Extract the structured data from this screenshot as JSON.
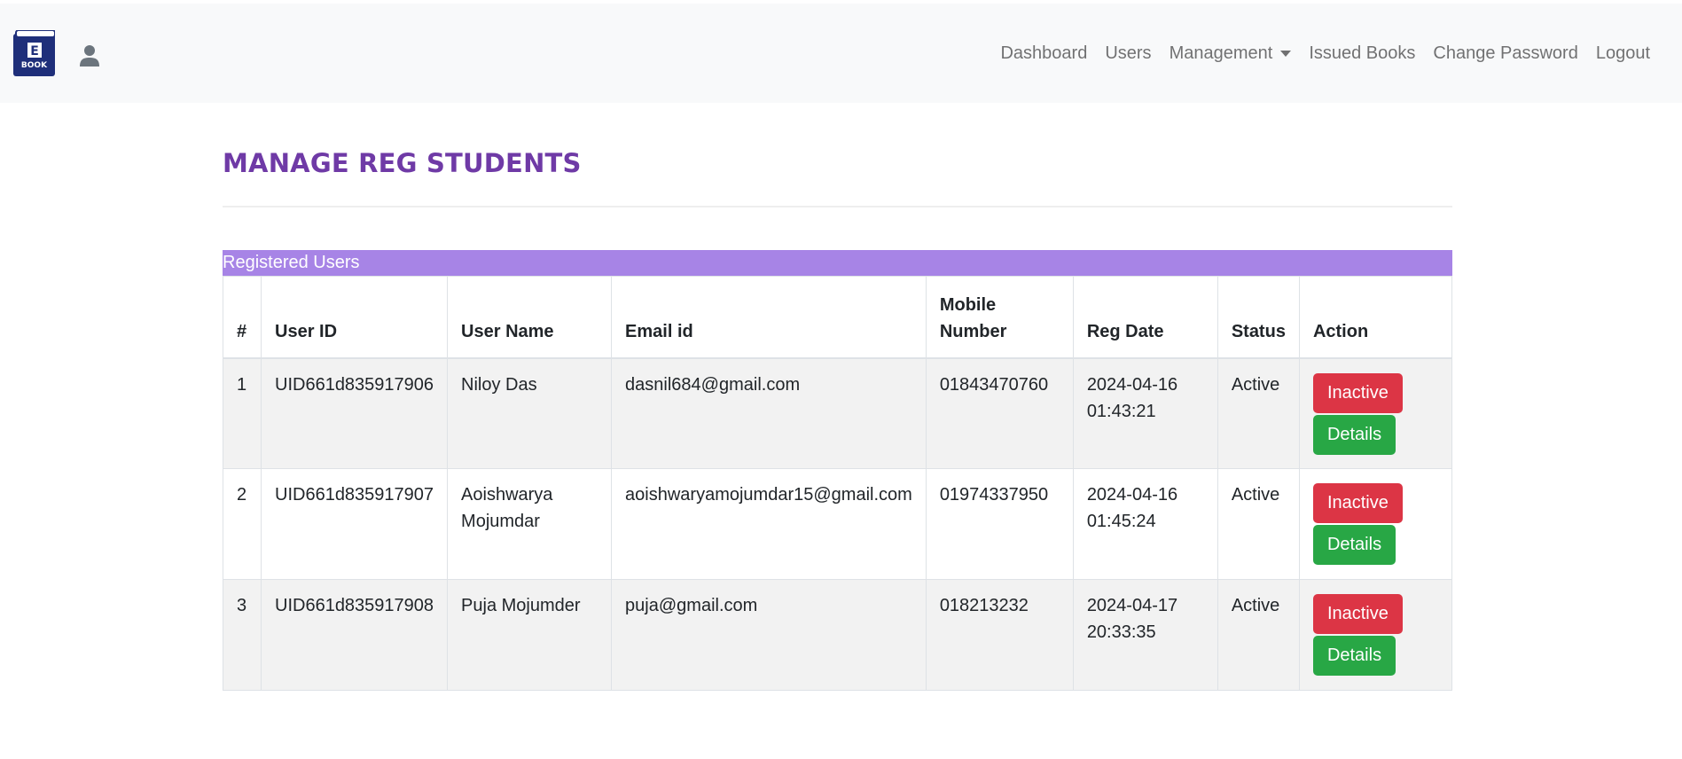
{
  "nav": {
    "links": [
      "Dashboard",
      "Users",
      "Management",
      "Issued Books",
      "Change Password",
      "Logout"
    ],
    "logo_text": [
      "E",
      "BOOK"
    ]
  },
  "page": {
    "title": "MANAGE REG STUDENTS",
    "panel_heading": "Registered Users"
  },
  "table": {
    "headers": [
      "#",
      "User ID",
      "User Name",
      "Email id",
      "Mobile Number",
      "Reg Date",
      "Status",
      "Action"
    ],
    "rows": [
      {
        "num": "1",
        "user_id": "UID661d835917906",
        "user_name": "Niloy Das",
        "email": "dasnil684@gmail.com",
        "mobile": "01843470760",
        "reg_date": "2024-04-16 01:43:21",
        "status": "Active",
        "toggle_label": "Inactive",
        "details_label": "Details"
      },
      {
        "num": "2",
        "user_id": "UID661d835917907",
        "user_name": "Aoishwarya Mojumdar",
        "email": "aoishwaryamojumdar15@gmail.com",
        "mobile": "01974337950",
        "reg_date": "2024-04-16 01:45:24",
        "status": "Active",
        "toggle_label": "Inactive",
        "details_label": "Details"
      },
      {
        "num": "3",
        "user_id": "UID661d835917908",
        "user_name": "Puja Mojumder",
        "email": "puja@gmail.com",
        "mobile": "018213232",
        "reg_date": "2024-04-17 20:33:35",
        "status": "Active",
        "toggle_label": "Inactive",
        "details_label": "Details"
      }
    ]
  },
  "colors": {
    "title": "#6f3aa6",
    "panel_heading_bg": "#a784e6",
    "danger": "#dc3545",
    "success": "#28a745",
    "logo_bg": "#1f2f7a"
  },
  "icons": {
    "brand": "book-logo-icon",
    "user": "user-icon",
    "dropdown": "caret-down-icon"
  }
}
